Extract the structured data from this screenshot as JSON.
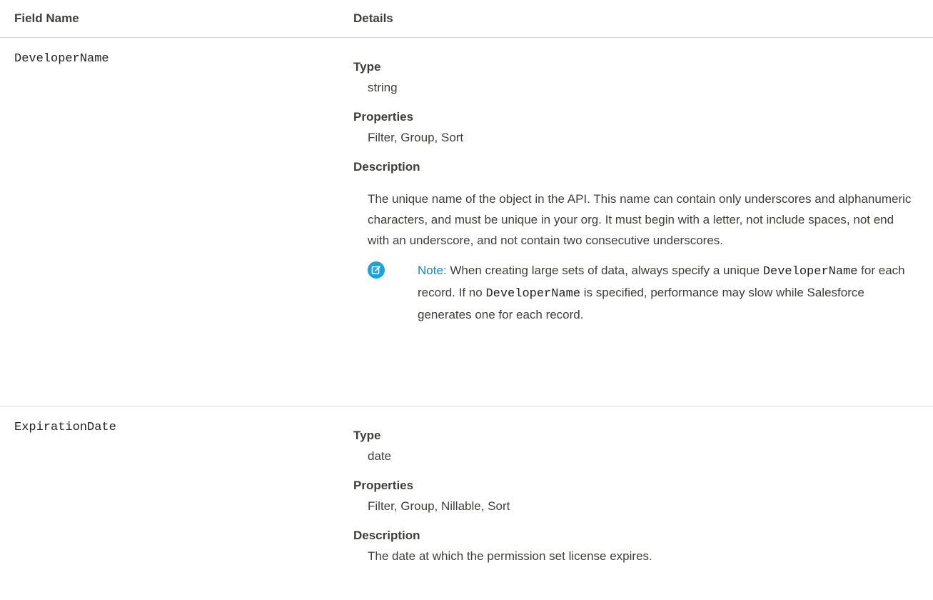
{
  "header": {
    "field_name_label": "Field Name",
    "details_label": "Details"
  },
  "rows": [
    {
      "field_name": "DeveloperName",
      "type_label": "Type",
      "type_value": "string",
      "properties_label": "Properties",
      "properties_value": "Filter, Group, Sort",
      "description_label": "Description",
      "description_value": "The unique name of the object in the API. This name can contain only underscores and alphanumeric characters, and must be unique in your org. It must begin with a letter, not include spaces, not end with an underscore, and not contain two consecutive underscores.",
      "note": {
        "label": "Note:",
        "text_1": " When creating large sets of data, always specify a unique ",
        "code_1": "DeveloperName",
        "text_2": " for each record. If no ",
        "code_2": "DeveloperName",
        "text_3": " is specified, performance may slow while Salesforce generates one for each record."
      }
    },
    {
      "field_name": "ExpirationDate",
      "type_label": "Type",
      "type_value": "date",
      "properties_label": "Properties",
      "properties_value": "Filter, Group, Nillable, Sort",
      "description_label": "Description",
      "description_value": "The date at which the permission set license expires."
    }
  ],
  "icons": {
    "note": "edit-note-icon"
  },
  "colors": {
    "note_label": "#0b87c9",
    "note_icon_bg": "#1ca2dd",
    "divider": "#d8d8d8"
  }
}
